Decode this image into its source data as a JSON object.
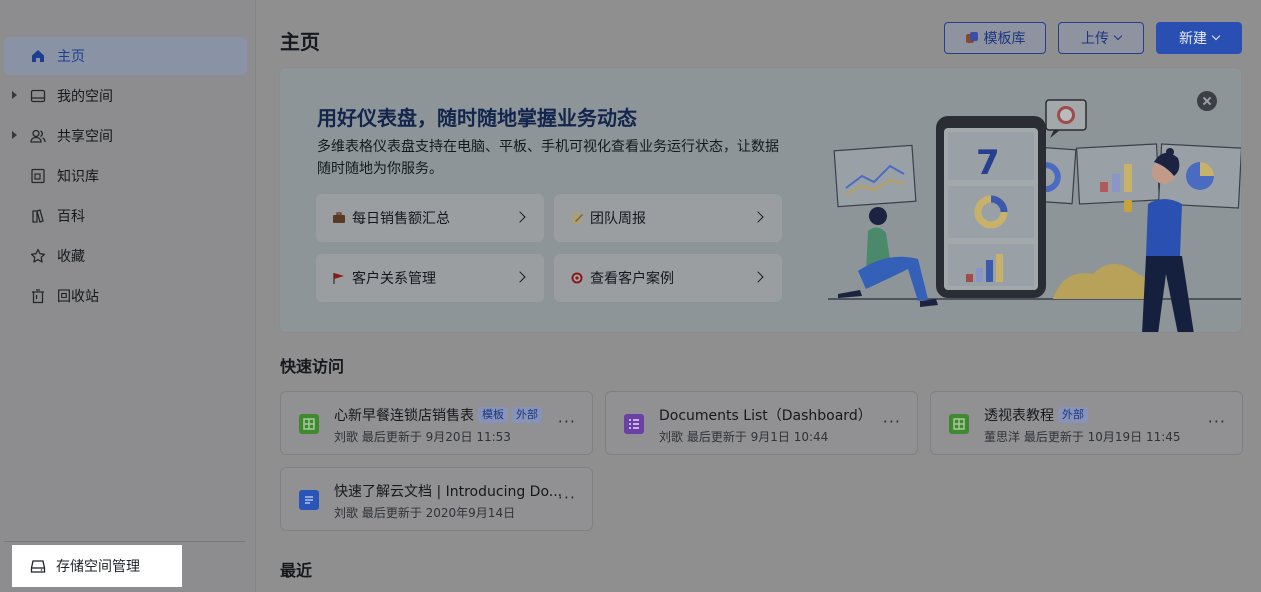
{
  "sidebar": {
    "items": [
      {
        "label": "主页",
        "icon": "home-icon",
        "active": true
      },
      {
        "label": "我的空间",
        "icon": "folder-icon",
        "expandable": true
      },
      {
        "label": "共享空间",
        "icon": "users-icon",
        "expandable": true
      },
      {
        "label": "知识库",
        "icon": "book-icon"
      },
      {
        "label": "百科",
        "icon": "encyclopedia-icon"
      },
      {
        "label": "收藏",
        "icon": "star-icon"
      },
      {
        "label": "回收站",
        "icon": "trash-icon"
      }
    ],
    "storage_label": "存储空间管理"
  },
  "header": {
    "title": "主页",
    "template_label": "模板库",
    "upload_label": "上传",
    "new_label": "新建"
  },
  "banner": {
    "title": "用好仪表盘，随时随地掌握业务动态",
    "desc": "多维表格仪表盘支持在电脑、平板、手机可视化查看业务运行状态，让数据随时随地为你服务。",
    "cards": [
      {
        "label": "每日销售额汇总",
        "icon": "briefcase-icon"
      },
      {
        "label": "团队周报",
        "icon": "memo-icon"
      },
      {
        "label": "客户关系管理",
        "icon": "flag-icon"
      },
      {
        "label": "查看客户案例",
        "icon": "target-icon"
      }
    ],
    "phone_number": "7"
  },
  "quick": {
    "title": "快速访问",
    "docs": [
      {
        "name": "心新早餐连锁店销售表",
        "tags": [
          "模板",
          "外部"
        ],
        "meta": "刘歌 最后更新于 9月20日 11:53",
        "type": "sheet"
      },
      {
        "name": "Documents List（Dashboard）",
        "tags": [],
        "meta": "刘歌 最后更新于 9月1日 10:44",
        "type": "base"
      },
      {
        "name": "透视表教程",
        "tags": [
          "外部"
        ],
        "meta": "董思洋 最后更新于 10月19日 11:45",
        "type": "sheet"
      },
      {
        "name": "快速了解云文档 | Introducing Do...",
        "tags": [],
        "meta": "刘歌 最后更新于 2020年9月14日",
        "type": "doc"
      }
    ],
    "more_label": "···"
  },
  "recent": {
    "title": "最近"
  },
  "colors": {
    "accent": "#2a4fb2",
    "sheet": "#3f8a2e",
    "base": "#6a3fa6",
    "doc": "#2a55b8"
  }
}
